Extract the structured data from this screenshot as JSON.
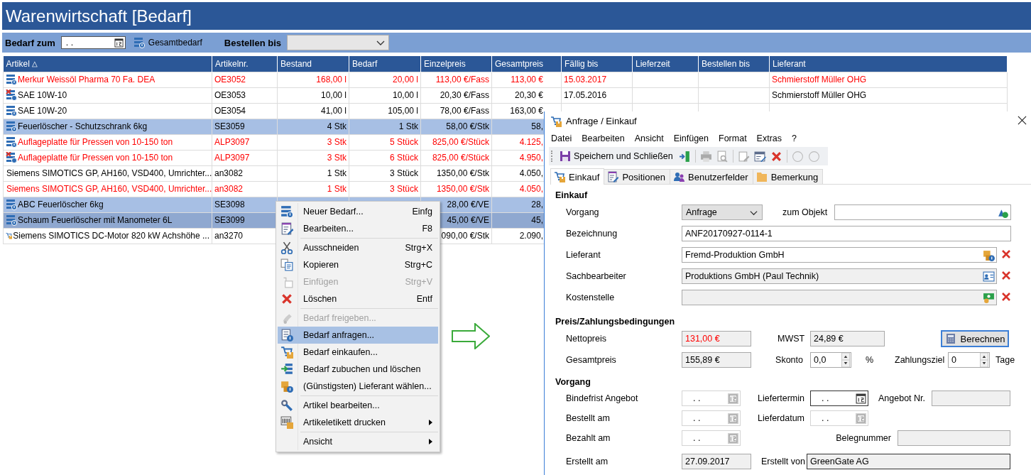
{
  "app": {
    "title": "Warenwirtschaft [Bedarf]"
  },
  "filter_bar": {
    "date_label": "Bedarf zum",
    "date_value": ". .",
    "total_button": "Gesamtbedarf",
    "order_label": "Bestellen bis"
  },
  "table": {
    "columns": [
      {
        "label": "Artikel",
        "sort_mark": "△"
      },
      {
        "label": "Artikelnr."
      },
      {
        "label": "Bestand"
      },
      {
        "label": "Bedarf"
      },
      {
        "label": "Einzelpreis"
      },
      {
        "label": "Gesamtpreis"
      },
      {
        "label": "Fällig bis"
      },
      {
        "label": "Lieferzeit"
      },
      {
        "label": "Bestellen bis"
      },
      {
        "label": "Lieferant"
      }
    ],
    "rows": [
      {
        "kind": "request",
        "alert": true,
        "selected": false,
        "current": false,
        "cells": {
          "artikel": "Merkur Weissöl Pharma 70 Fa. DEA",
          "artikelnr": "OE3052",
          "bestand": "168,00 l",
          "bedarf": "20,00 l",
          "einzelpreis": "113,00 €/Fass",
          "gesamtpreis": "113,00 €",
          "faellig_bis": "15.03.2017",
          "lieferant": "Schmierstoff Müller OHG"
        }
      },
      {
        "kind": "blocked",
        "alert": false,
        "selected": false,
        "current": false,
        "cells": {
          "artikel": "SAE 10W-10",
          "artikelnr": "OE3053",
          "bestand": "10,00 l",
          "bedarf": "10,00 l",
          "einzelpreis": "20,30 €/Fass",
          "gesamtpreis": "20,30 €",
          "faellig_bis": "17.05.2016",
          "lieferant": "Schmierstoff Müller OHG"
        }
      },
      {
        "kind": "request",
        "alert": false,
        "selected": false,
        "current": false,
        "cells": {
          "artikel": "SAE 10W-20",
          "artikelnr": "OE3054",
          "bestand": "41,00 l",
          "bedarf": "105,00 l",
          "einzelpreis": "78,00 €/Fass",
          "gesamtpreis": "163,00 €"
        }
      },
      {
        "kind": "request",
        "alert": false,
        "selected": true,
        "current": false,
        "cells": {
          "artikel": "Feuerlöscher - Schutzschrank 6kg",
          "artikelnr": "SE3059",
          "bestand": "4 Stk",
          "bedarf": "1 Stk",
          "einzelpreis": "58,00 €/Stk",
          "gesamtpreis": "58,"
        }
      },
      {
        "kind": "request",
        "alert": true,
        "selected": false,
        "current": false,
        "cells": {
          "artikel": "Auflageplatte für Pressen von 10-150 ton",
          "artikelnr": "ALP3097",
          "bestand": "3 Stk",
          "bedarf": "5 Stück",
          "einzelpreis": "825,00 €/Stück",
          "gesamtpreis": "4.125,"
        }
      },
      {
        "kind": "blocked",
        "alert": true,
        "selected": false,
        "current": false,
        "cells": {
          "artikel": "Auflageplatte für Pressen von 10-150 ton",
          "artikelnr": "ALP3097",
          "bestand": "3 Stk",
          "bedarf": "6 Stück",
          "einzelpreis": "825,00 €/Stück",
          "gesamtpreis": "4.950,"
        }
      },
      {
        "kind": "purchase",
        "alert": false,
        "selected": false,
        "current": false,
        "cells": {
          "artikel": "Siemens SIMOTICS GP, AH160, VSD400, Umrichter...",
          "artikelnr": "an3082",
          "bestand": "1 Stk",
          "bedarf": "3 Stück",
          "einzelpreis": "1350,00 €/Stk",
          "gesamtpreis": "4.050,"
        }
      },
      {
        "kind": "purchase",
        "alert": true,
        "selected": false,
        "current": false,
        "cells": {
          "artikel": "Siemens SIMOTICS GP, AH160, VSD400, Umrichter...",
          "artikelnr": "an3082",
          "bestand": "1 Stk",
          "bedarf": "3 Stück",
          "einzelpreis": "1350,00 €/Stk",
          "gesamtpreis": "4.050,"
        }
      },
      {
        "kind": "request",
        "alert": false,
        "selected": true,
        "current": false,
        "cells": {
          "artikel": "ABC Feuerlöscher  6kg",
          "artikelnr": "SE3098",
          "einzelpreis": "28,00 €/VE",
          "gesamtpreis": "28,"
        }
      },
      {
        "kind": "request",
        "alert": false,
        "selected": true,
        "current": true,
        "cells": {
          "artikel": "Schaum Feuerlöscher mit Manometer 6L",
          "artikelnr": "SE3099",
          "einzelpreis": "45,00 €/VE",
          "gesamtpreis": "45,"
        }
      },
      {
        "kind": "purchase",
        "alert": false,
        "selected": false,
        "current": false,
        "cells": {
          "artikel": "Siemens SIMOTICS DC-Motor 820 kW  Achshöhe ...",
          "artikelnr": "an3270",
          "einzelpreis": "090,00 €/Stk",
          "gesamtpreis": "2.090,"
        }
      }
    ]
  },
  "context_menu": {
    "groups": [
      [
        {
          "kind": "new",
          "label": "Neuer Bedarf...",
          "shortcut": "Einfg",
          "disabled": false,
          "selected": false
        },
        {
          "kind": "edit",
          "label": "Bearbeiten...",
          "shortcut": "F8",
          "disabled": false,
          "selected": false
        }
      ],
      [
        {
          "kind": "cut",
          "label": "Ausschneiden",
          "shortcut": "Strg+X",
          "disabled": false,
          "selected": false
        },
        {
          "kind": "copy",
          "label": "Kopieren",
          "shortcut": "Strg+C",
          "disabled": false,
          "selected": false
        },
        {
          "kind": "paste",
          "label": "Einfügen",
          "shortcut": "Strg+V",
          "disabled": true,
          "selected": false
        },
        {
          "kind": "delete",
          "label": "Löschen",
          "shortcut": "Entf",
          "disabled": false,
          "selected": false
        }
      ],
      [
        {
          "kind": "release",
          "label": "Bedarf freigeben...",
          "disabled": true,
          "selected": false
        },
        {
          "kind": "request",
          "label": "Bedarf anfragen...",
          "disabled": false,
          "selected": true
        },
        {
          "kind": "purchase",
          "label": "Bedarf einkaufen...",
          "disabled": false,
          "selected": false
        },
        {
          "kind": "book",
          "label": "Bedarf zubuchen und löschen",
          "disabled": false,
          "selected": false
        },
        {
          "kind": "supplier",
          "label": "(Günstigsten) Lieferant wählen...",
          "disabled": false,
          "selected": false
        }
      ],
      [
        {
          "kind": "article",
          "label": "Artikel bearbeiten...",
          "disabled": false,
          "selected": false
        },
        {
          "kind": "label",
          "label": "Artikeletikett drucken",
          "submenu": true,
          "disabled": false,
          "selected": false
        }
      ],
      [
        {
          "kind": "plain",
          "label": "Ansicht",
          "submenu": true,
          "disabled": false,
          "selected": false
        }
      ]
    ]
  },
  "dialog": {
    "title": "Anfrage / Einkauf",
    "menu": [
      "Datei",
      "Bearbeiten",
      "Ansicht",
      "Einfügen",
      "Format",
      "Extras",
      "?"
    ],
    "save_button": "Speichern und Schließen",
    "tabs": [
      {
        "kind": "cart",
        "label": "Einkauf",
        "selected": true
      },
      {
        "kind": "document",
        "label": "Positionen",
        "selected": false
      },
      {
        "kind": "people",
        "label": "Benutzerfelder",
        "selected": false
      },
      {
        "kind": "folder",
        "label": "Bemerkung",
        "selected": false
      }
    ],
    "sections": [
      {
        "heading": "Einkauf",
        "rows": [
          {
            "kind": "objekt",
            "items": [
              {
                "kind": "label",
                "text": "Vorgang"
              },
              {
                "kind": "combo",
                "value": "Anfrage"
              },
              {
                "kind": "label",
                "text": "zum Objekt"
              },
              {
                "kind": "object-lookup",
                "readonly": false
              }
            ]
          },
          {
            "kind": "text",
            "items": [
              {
                "kind": "label",
                "text": "Bezeichnung"
              },
              {
                "kind": "text",
                "value": "ANF20170927-0114-1",
                "readonly": false
              }
            ]
          },
          {
            "kind": "lookup",
            "items": [
              {
                "kind": "label",
                "text": "Lieferant"
              },
              {
                "kind": "supplier-lookup",
                "value": "Fremd-Produktion GmbH",
                "readonly": false
              }
            ]
          },
          {
            "kind": "lookup",
            "items": [
              {
                "kind": "label",
                "text": "Sachbearbeiter"
              },
              {
                "kind": "person-lookup",
                "value": "Produktions GmbH  (Paul Technik)",
                "readonly": true
              }
            ]
          },
          {
            "kind": "lookup",
            "items": [
              {
                "kind": "label",
                "text": "Kostenstelle"
              },
              {
                "kind": "cost-lookup",
                "readonly": true
              }
            ]
          }
        ]
      },
      {
        "heading": "Preis/Zahlungsbedingungen",
        "rows": [
          {
            "kind": "price",
            "items": [
              {
                "kind": "label",
                "text": "Nettopreis"
              },
              {
                "kind": "text",
                "value": "131,00 €",
                "readonly": true,
                "alert": true
              },
              {
                "kind": "label",
                "text": "MWST"
              },
              {
                "kind": "text",
                "value": "24,89 €",
                "readonly": true
              },
              {
                "kind": "button",
                "text": "Berechnen"
              }
            ]
          },
          {
            "kind": "gesamt",
            "items": [
              {
                "kind": "label",
                "text": "Gesamtpreis"
              },
              {
                "kind": "text",
                "value": "155,89 €",
                "readonly": true
              },
              {
                "kind": "label",
                "text": "Skonto"
              },
              {
                "kind": "spin",
                "value": "0,0"
              },
              {
                "kind": "label",
                "text": "%"
              },
              {
                "kind": "label",
                "text": "Zahlungsziel"
              },
              {
                "kind": "spin",
                "value": "0"
              },
              {
                "kind": "label",
                "text": "Tage"
              }
            ]
          }
        ]
      },
      {
        "heading": "Vorgang",
        "rows": [
          {
            "kind": "date",
            "items": [
              {
                "kind": "label",
                "text": "Bindefrist Angebot"
              },
              {
                "kind": "date",
                "value": ". .",
                "disabled": true
              },
              {
                "kind": "label",
                "text": "Liefertermin"
              },
              {
                "kind": "date",
                "value": ". .",
                "disabled": false
              },
              {
                "kind": "label",
                "text": "Angebot Nr."
              },
              {
                "kind": "text",
                "readonly": true
              }
            ]
          },
          {
            "kind": "date",
            "items": [
              {
                "kind": "label",
                "text": "Bestellt am"
              },
              {
                "kind": "date",
                "value": ". .",
                "disabled": true
              },
              {
                "kind": "label",
                "text": "Lieferdatum"
              },
              {
                "kind": "date",
                "value": ". .",
                "disabled": true
              }
            ]
          },
          {
            "kind": "date3",
            "items": [
              {
                "kind": "label",
                "text": "Bezahlt am"
              },
              {
                "kind": "date",
                "value": ". .",
                "disabled": true
              },
              {
                "kind": "label",
                "text": "Belegnummer"
              },
              {
                "kind": "text",
                "readonly": true
              }
            ]
          },
          {
            "kind": "created",
            "items": [
              {
                "kind": "label",
                "text": "Erstellt am"
              },
              {
                "kind": "text",
                "value": "27.09.2017",
                "readonly": true
              },
              {
                "kind": "label",
                "text": "Erstellt von"
              },
              {
                "kind": "text",
                "value": "GreenGate AG",
                "readonly": true,
                "focused": true
              }
            ]
          }
        ]
      }
    ]
  }
}
